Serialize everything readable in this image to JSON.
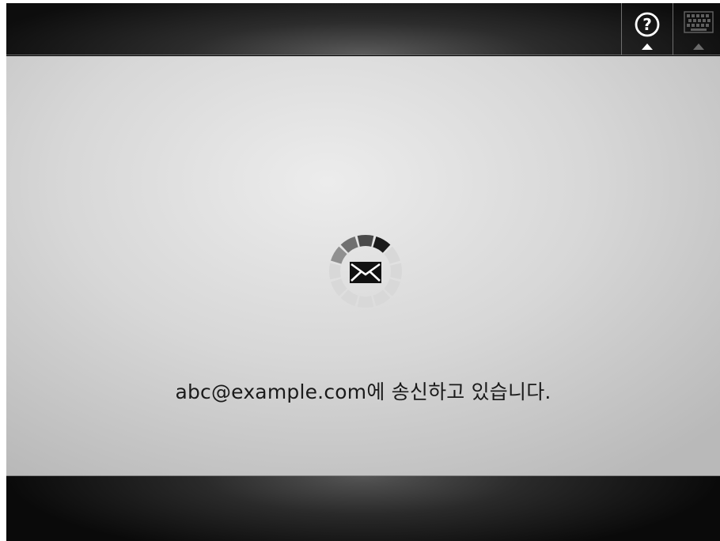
{
  "header": {
    "help_button": {
      "icon": "help-icon",
      "label": "?"
    },
    "keyboard_button": {
      "icon": "keyboard-icon"
    }
  },
  "main": {
    "status_icon": "envelope-icon",
    "progress_spinner": "loading-spinner",
    "message": "abc@example.com에 송신하고 있습니다."
  },
  "colors": {
    "bar_dark": "#1a1a1a",
    "content_light": "#e6e6e6",
    "spinner_active": "#1a1a1a",
    "spinner_inactive": "#d4d4d4"
  }
}
